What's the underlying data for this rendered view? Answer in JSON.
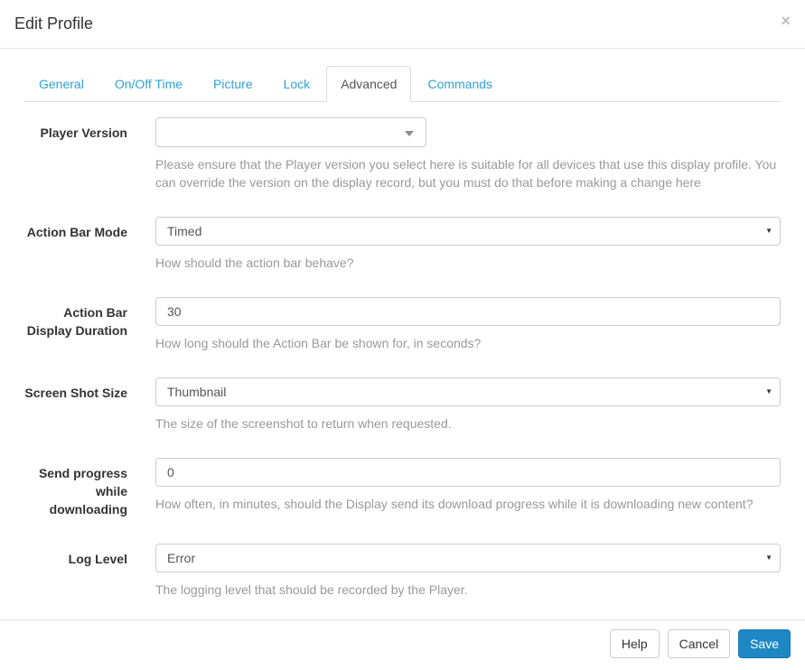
{
  "modal": {
    "title": "Edit Profile",
    "close_icon": "×"
  },
  "tabs": [
    {
      "label": "General",
      "active": false
    },
    {
      "label": "On/Off Time",
      "active": false
    },
    {
      "label": "Picture",
      "active": false
    },
    {
      "label": "Lock",
      "active": false
    },
    {
      "label": "Advanced",
      "active": true
    },
    {
      "label": "Commands",
      "active": false
    }
  ],
  "fields": [
    {
      "label": "Player Version",
      "type": "select2-dropdown",
      "value": "",
      "help": "Please ensure that the Player version you select here is suitable for all devices that use this display profile. You can override the version on the display record, but you must do that before making a change here"
    },
    {
      "label": "Action Bar Mode",
      "type": "select",
      "value": "Timed",
      "help": "How should the action bar behave?"
    },
    {
      "label": "Action Bar Display Duration",
      "type": "text-input",
      "value": "30",
      "help": "How long should the Action Bar be shown for, in seconds?"
    },
    {
      "label": "Screen Shot Size",
      "type": "select",
      "value": "Thumbnail",
      "help": "The size of the screenshot to return when requested."
    },
    {
      "label": "Send progress while downloading",
      "type": "text-input",
      "value": "0",
      "help": "How often, in minutes, should the Display send its download progress while it is downloading new content?"
    },
    {
      "label": "Log Level",
      "type": "select",
      "value": "Error",
      "help": "The logging level that should be recorded by the Player."
    }
  ],
  "footer": {
    "help_label": "Help",
    "cancel_label": "Cancel",
    "save_label": "Save"
  },
  "colors": {
    "link_blue": "#30a2d9",
    "primary_button_blue": "#1e88c5",
    "help_text_gray": "#999999",
    "border_gray": "#cccccc"
  }
}
